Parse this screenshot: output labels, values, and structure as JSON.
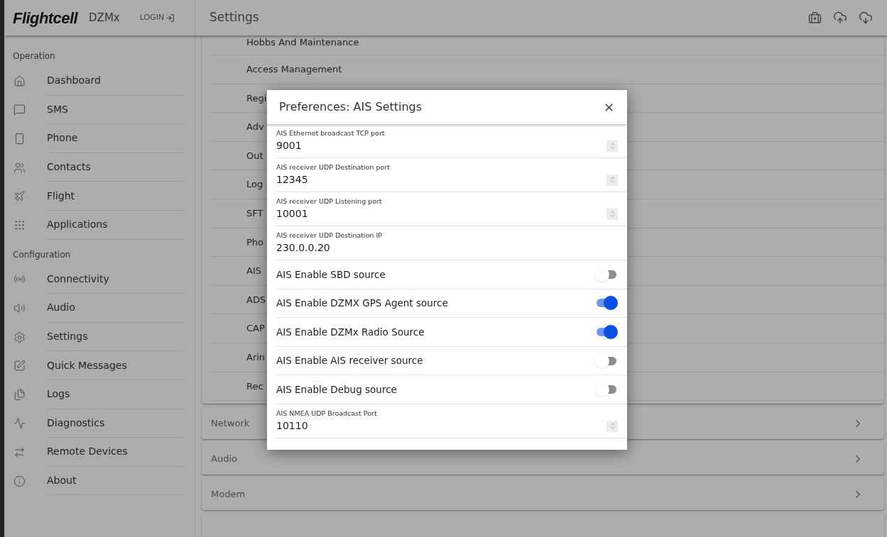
{
  "header": {
    "logo": "Flightcell",
    "product": "DZMx",
    "login": "LOGIN",
    "title": "Settings"
  },
  "sidebar": [
    {
      "heading": "Operation",
      "items": [
        {
          "label": "Dashboard"
        },
        {
          "label": "SMS"
        },
        {
          "label": "Phone"
        },
        {
          "label": "Contacts"
        },
        {
          "label": "Flight"
        },
        {
          "label": "Applications"
        }
      ]
    },
    {
      "heading": "Configuration",
      "items": [
        {
          "label": "Connectivity"
        },
        {
          "label": "Audio"
        },
        {
          "label": "Settings"
        },
        {
          "label": "Quick Messages"
        },
        {
          "label": "Logs"
        },
        {
          "label": "Diagnostics"
        },
        {
          "label": "Remote Devices"
        },
        {
          "label": "About"
        }
      ]
    }
  ],
  "settings_list": [
    "Hobbs And Maintenance",
    "Access Management",
    "Regi",
    "Adv",
    "Out",
    "Log",
    "SFT",
    "Pho",
    "AIS",
    "ADS",
    "CAP",
    "Arin",
    "Rec"
  ],
  "sections": [
    "Network",
    "Audio",
    "Modem"
  ],
  "dialog": {
    "title": "Preferences: AIS Settings",
    "rows": [
      {
        "kind": "number",
        "label": "AIS Ethernet broadcast TCP port",
        "value": "9001"
      },
      {
        "kind": "number",
        "label": "AIS receiver UDP Destination port",
        "value": "12345"
      },
      {
        "kind": "number",
        "label": "AIS receiver UDP Listening port",
        "value": "10001"
      },
      {
        "kind": "text",
        "label": "AIS receiver UDP Destination IP",
        "value": "230.0.0.20"
      },
      {
        "kind": "toggle",
        "label": "AIS Enable SBD source",
        "on": false
      },
      {
        "kind": "toggle",
        "label": "AIS Enable DZMX GPS Agent source",
        "on": true
      },
      {
        "kind": "toggle",
        "label": "AIS Enable DZMx Radio Source",
        "on": true
      },
      {
        "kind": "toggle",
        "label": "AIS Enable AIS receiver source",
        "on": false
      },
      {
        "kind": "toggle",
        "label": "AIS Enable Debug source",
        "on": false
      },
      {
        "kind": "number",
        "label": "AIS NMEA UDP Broadcast Port",
        "value": "10110"
      }
    ]
  }
}
